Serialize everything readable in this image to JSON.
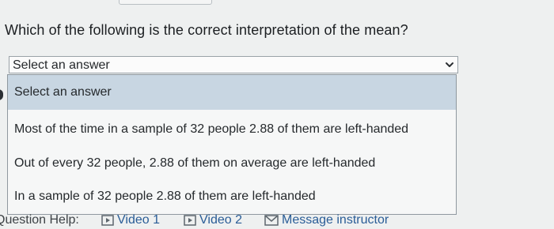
{
  "question": {
    "text": "Which of the following is the correct interpretation of the mean?"
  },
  "select": {
    "value": "Select an answer",
    "options": [
      "Select an answer",
      "Most of the time in a sample of 32 people 2.88 of them are left-handed",
      "Out of every 32 people, 2.88 of them on average are left-handed",
      "In a sample of 32 people 2.88 of them are left-handed"
    ],
    "selected_index": 0
  },
  "help": {
    "label": "Question Help:",
    "links": [
      {
        "label": "Video 1",
        "icon": "play-icon"
      },
      {
        "label": "Video 2",
        "icon": "play-icon"
      },
      {
        "label": "Message instructor",
        "icon": "mail-icon"
      }
    ]
  },
  "colors": {
    "selected_option": "#c8d6e2",
    "link": "#2a5d97"
  }
}
